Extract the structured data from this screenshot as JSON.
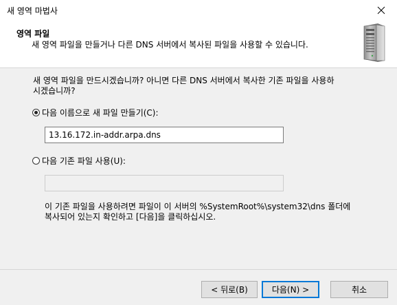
{
  "window": {
    "title": "새 영역 마법사"
  },
  "header": {
    "title": "영역 파일",
    "subtitle": "새 영역 파일을 만들거나 다른 DNS 서버에서 복사된 파일을 사용할 수 있습니다."
  },
  "body": {
    "question_line1": "새 영역 파일을 만드시겠습니까? 아니면 다른 DNS 서버에서 복사한 기존 파일을 사용하",
    "question_line2": "시겠습니까?",
    "option_new": {
      "label": "다음 이름으로 새 파일 만들기(C):",
      "selected": true,
      "value": "13.16.172.in-addr.arpa.dns"
    },
    "option_existing": {
      "label": "다음 기존 파일 사용(U):",
      "selected": false,
      "value": ""
    },
    "note_line1": "이 기존 파일을 사용하려면 파일이 이 서버의 %SystemRoot%\\system32\\dns 폴더에",
    "note_line2": "복사되어 있는지 확인하고 [다음]을 클릭하십시오."
  },
  "footer": {
    "back_label": "< 뒤로(B)",
    "next_label": "다음(N) >",
    "cancel_label": "취소"
  },
  "colors": {
    "accent": "#0078d7",
    "panel": "#f0f0f0",
    "button": "#e1e1e1"
  }
}
